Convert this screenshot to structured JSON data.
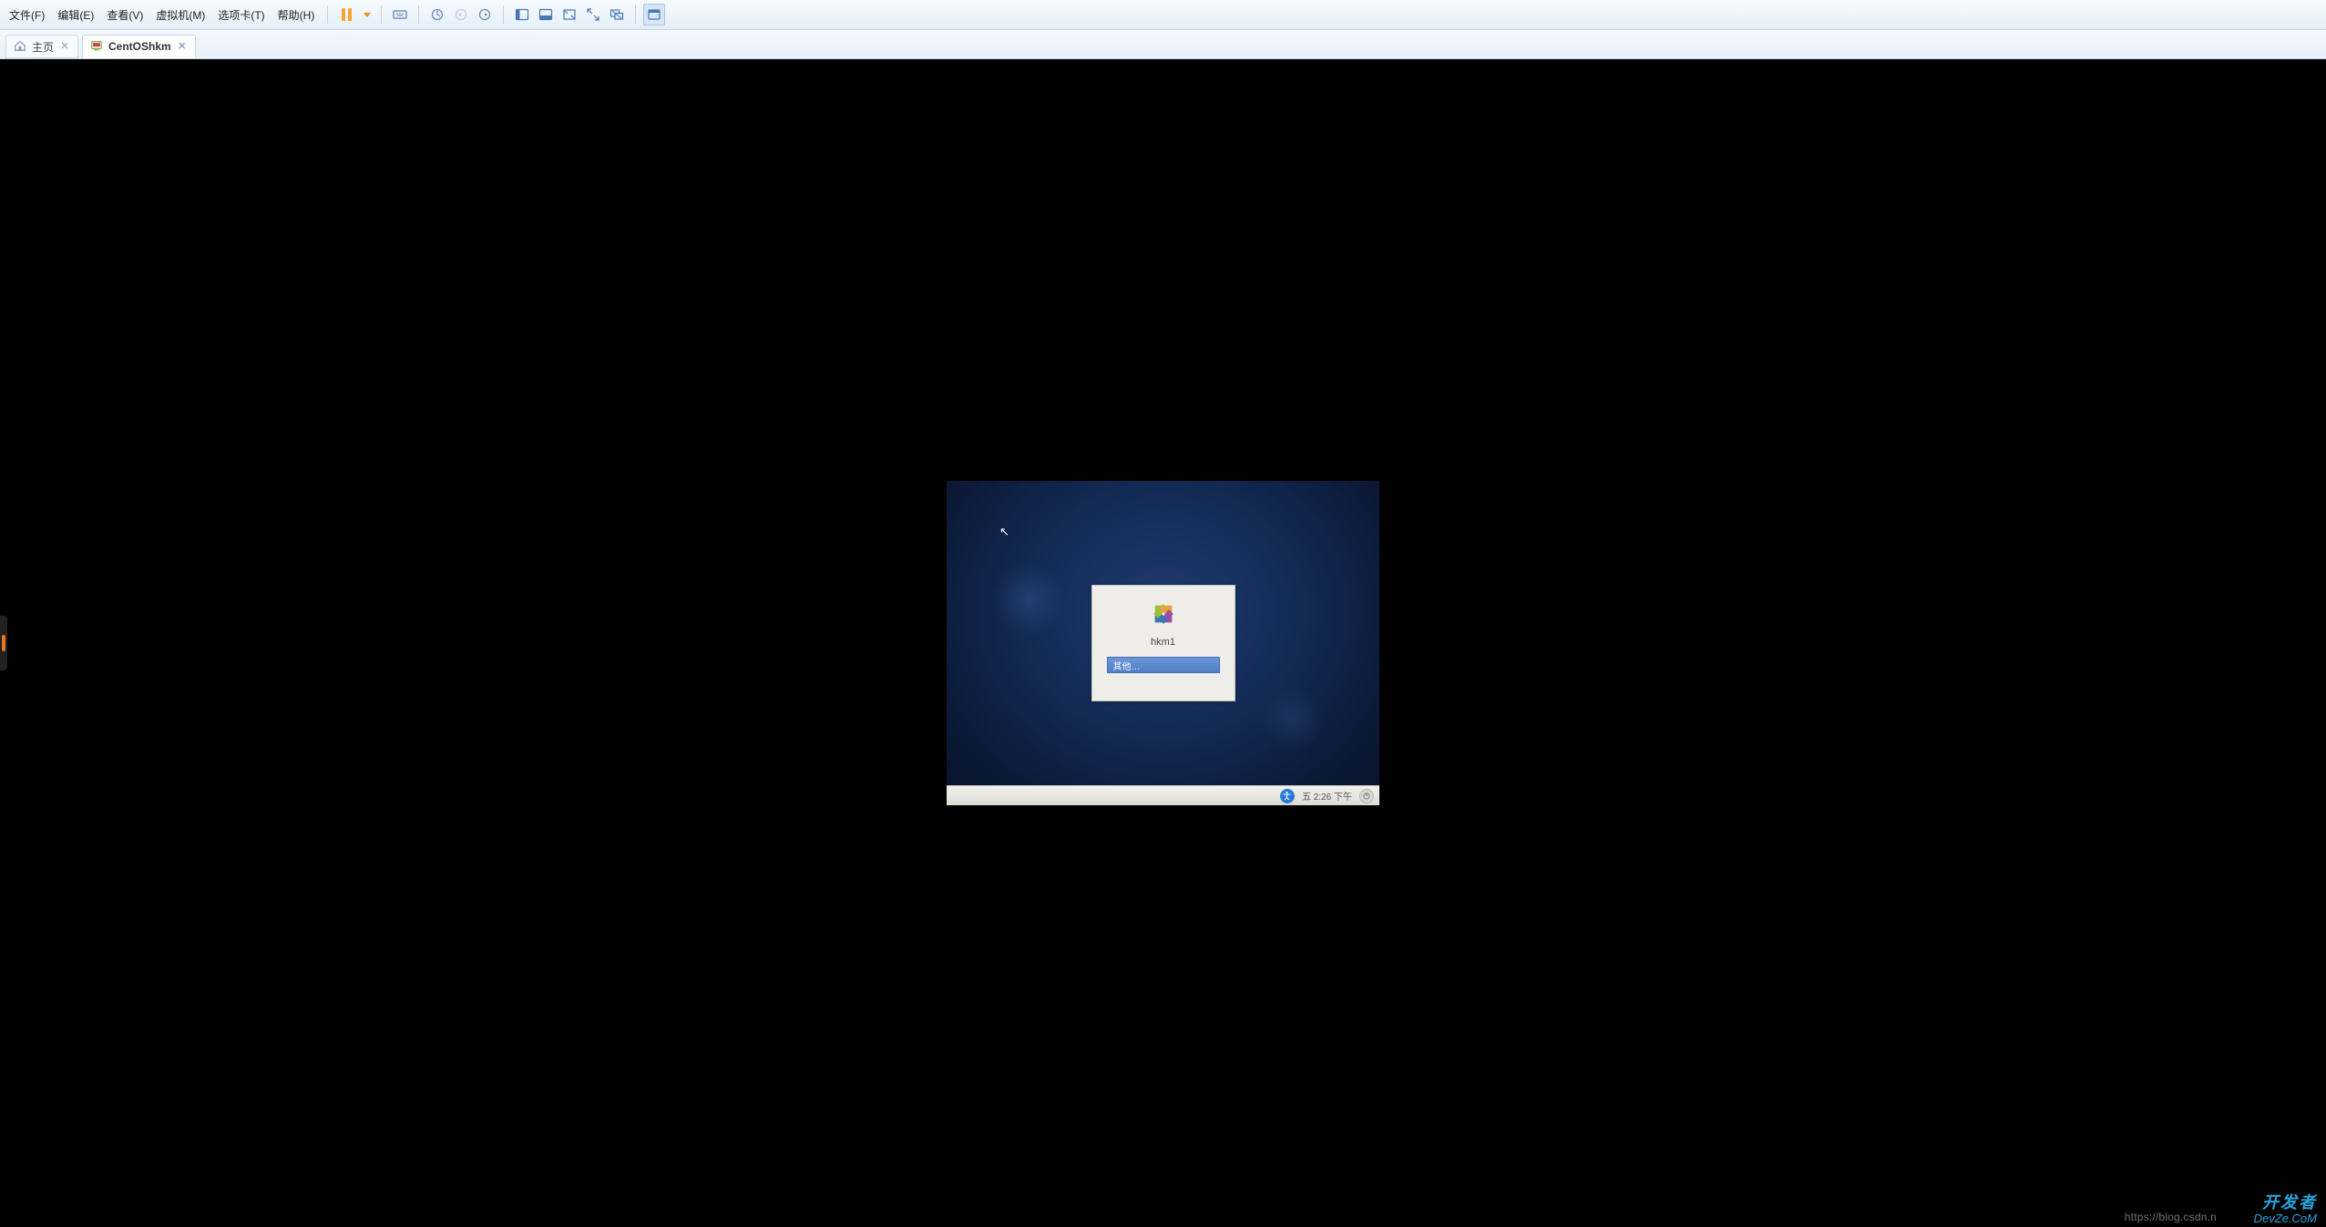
{
  "menu": {
    "file": "文件(F)",
    "edit": "编辑(E)",
    "view": "查看(V)",
    "vm": "虚拟机(M)",
    "tabs": "选项卡(T)",
    "help": "帮助(H)"
  },
  "tabs": {
    "home": "主页",
    "vm": "CentOShkm"
  },
  "guest": {
    "hostname": "hkm1",
    "other_user": "其他…",
    "clock": "五  2:26 下午"
  },
  "watermark": {
    "url": "https://blog.csdn.n",
    "line1": "开发者",
    "line2": "DevZe.CoM"
  },
  "colors": {
    "accent_orange": "#f7a531",
    "accent_blue": "#2d7ad6"
  }
}
